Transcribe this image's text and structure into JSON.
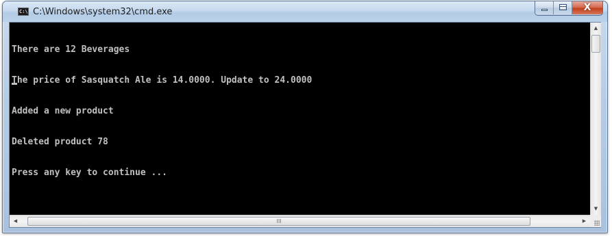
{
  "window": {
    "title": "C:\\Windows\\system32\\cmd.exe",
    "app_icon_text": "C:\\"
  },
  "caption_buttons": {
    "close_glyph": "X"
  },
  "console": {
    "lines": [
      "There are 12 Beverages",
      "The price of Sasquatch Ale is 14.0000. Update to 24.0000",
      "Added a new product",
      "Deleted product 78",
      "Press any key to continue ..."
    ]
  },
  "scrollbars": {
    "up_arrow": "▲",
    "down_arrow": "▼",
    "left_arrow": "◀",
    "right_arrow": "▶",
    "horizontal_thumb_grip": "III"
  },
  "colors": {
    "console_bg": "#000000",
    "console_text": "#c0c0c0",
    "close_button": "#c2401d"
  }
}
